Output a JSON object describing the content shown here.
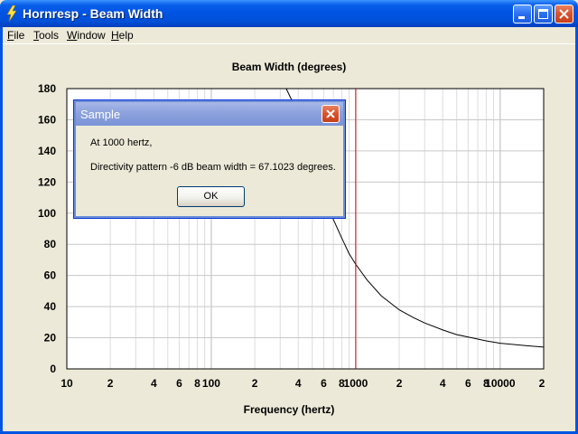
{
  "window": {
    "title": "Hornresp - Beam Width"
  },
  "menu": [
    {
      "u": "F",
      "rest": "ile"
    },
    {
      "u": "T",
      "rest": "ools"
    },
    {
      "u": "W",
      "rest": "indow"
    },
    {
      "u": "H",
      "rest": "elp"
    }
  ],
  "chart_data": {
    "type": "line",
    "title": "Beam Width (degrees)",
    "xlabel": "Frequency (hertz)",
    "ylabel": "",
    "x_scale": "log",
    "xlim": [
      10,
      20000
    ],
    "ylim": [
      0,
      180
    ],
    "y_ticks": [
      "0",
      "20",
      "40",
      "60",
      "80",
      "100",
      "120",
      "140",
      "160",
      "180"
    ],
    "x_tick_labels": [
      {
        "v": 10,
        "t": "10"
      },
      {
        "v": 20,
        "t": "2"
      },
      {
        "v": 40,
        "t": "4"
      },
      {
        "v": 60,
        "t": "6"
      },
      {
        "v": 80,
        "t": "8"
      },
      {
        "v": 100,
        "t": "100"
      },
      {
        "v": 200,
        "t": "2"
      },
      {
        "v": 400,
        "t": "4"
      },
      {
        "v": 600,
        "t": "6"
      },
      {
        "v": 800,
        "t": "8"
      },
      {
        "v": 1000,
        "t": "1000"
      },
      {
        "v": 2000,
        "t": "2"
      },
      {
        "v": 4000,
        "t": "4"
      },
      {
        "v": 6000,
        "t": "6"
      },
      {
        "v": 8000,
        "t": "8"
      },
      {
        "v": 10000,
        "t": "10000"
      },
      {
        "v": 20000,
        "t": "2"
      }
    ],
    "grid": true,
    "marker_x": 1000,
    "series": [
      {
        "color": "#000000",
        "x": [
          330,
          400,
          500,
          600,
          700,
          800,
          900,
          1000,
          1200,
          1500,
          2000,
          2500,
          3000,
          4000,
          5000,
          6000,
          8000,
          10000,
          15000,
          20000
        ],
        "y": [
          180,
          164,
          131,
          109,
          96,
          84,
          74,
          67.1,
          57,
          47,
          38,
          33,
          29.5,
          25,
          22,
          20.5,
          18,
          16.5,
          15,
          14
        ]
      }
    ],
    "marker_color": "#d00000"
  },
  "dialog": {
    "title": "Sample",
    "line1": "At 1000 hertz,",
    "line2": "Directivity pattern -6 dB beam width = 67.1023 degrees.",
    "ok_label": "OK"
  }
}
